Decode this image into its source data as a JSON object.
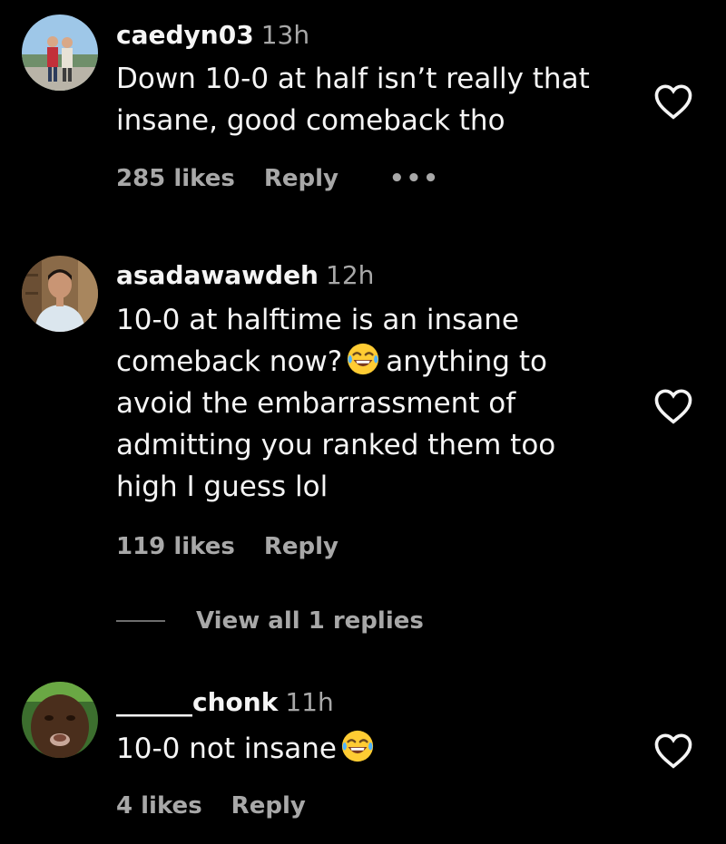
{
  "comments": [
    {
      "username": "caedyn03",
      "time": "13h",
      "text_lines": [
        "Down 10-0 at half isn’t really that",
        "insane, good comeback tho"
      ],
      "likes": "285 likes",
      "reply": "Reply",
      "more": "•••"
    },
    {
      "username": "asadawawdeh",
      "time": "12h",
      "text_lines": [
        "10-0 at halftime is an insane",
        "comeback now?",
        "anything to",
        "avoid the embarrassment of",
        "admitting you ranked them too",
        "high I guess lol"
      ],
      "likes": "119 likes",
      "reply": "Reply",
      "view_replies": "View all 1 replies"
    },
    {
      "username": "______chonk",
      "time": "11h",
      "text": "10-0 not insane",
      "likes": "4 likes",
      "reply": "Reply"
    }
  ],
  "icons": {
    "like": "heart-outline-icon",
    "emoji": "face-with-tears-of-joy-emoji"
  },
  "colors": {
    "background": "#000000",
    "primary_text": "#f5f5f5",
    "secondary_text": "#a8a8a8"
  }
}
